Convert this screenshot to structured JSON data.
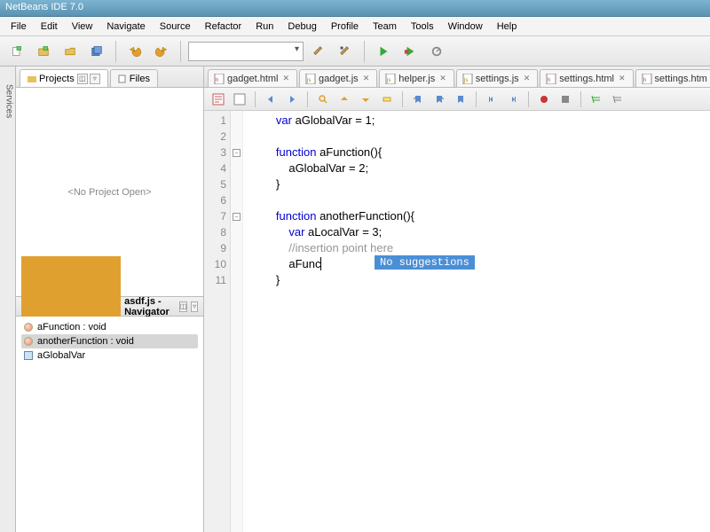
{
  "title": "NetBeans IDE 7.0",
  "menu": [
    "File",
    "Edit",
    "View",
    "Navigate",
    "Source",
    "Refactor",
    "Run",
    "Debug",
    "Profile",
    "Team",
    "Tools",
    "Window",
    "Help"
  ],
  "toolbar_combo": "",
  "left_tabs": {
    "projects": "Projects",
    "files": "Files"
  },
  "no_project": "<No Project Open>",
  "navigator": {
    "title": "asdf.js - Navigator",
    "items": [
      {
        "label": "aFunction : void"
      },
      {
        "label": "anotherFunction : void"
      },
      {
        "label": "aGlobalVar"
      }
    ]
  },
  "editor_tabs": [
    {
      "name": "gadget.html",
      "kind": "html"
    },
    {
      "name": "gadget.js",
      "kind": "js"
    },
    {
      "name": "helper.js",
      "kind": "js"
    },
    {
      "name": "settings.js",
      "kind": "js"
    },
    {
      "name": "settings.html",
      "kind": "html"
    },
    {
      "name": "settings.htm",
      "kind": "html"
    }
  ],
  "code": {
    "l1": "        var aGlobalVar = 1;",
    "l2": "",
    "l3a": "        function",
    "l3b": " aFunction(){",
    "l4": "            aGlobalVar = 2;",
    "l5": "        }",
    "l6": "",
    "l7a": "        function",
    "l7b": " anotherFunction(){",
    "l8a": "            var",
    "l8b": " aLocalVar = 3;",
    "l9": "            //insertion point here",
    "l10": "            aFunc",
    "l11": "        }"
  },
  "tooltip": "No suggestions",
  "var_kw": "var",
  "fn_kw": "function"
}
